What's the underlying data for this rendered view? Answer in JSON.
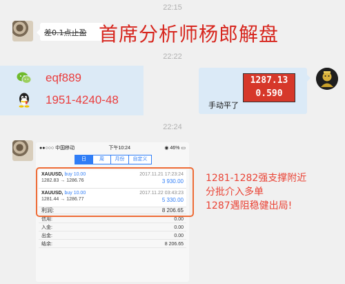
{
  "timestamps": [
    "22:15",
    "22:22",
    "22:24"
  ],
  "msg1": {
    "text": "差0.1点止盈",
    "watermark": "首席分析师杨郎解盘"
  },
  "contacts": {
    "wechat": "eqf889",
    "qq": "1951-4240-48",
    "wechat_icon": "wechat-icon",
    "qq_icon": "qq-icon"
  },
  "reply": {
    "price_line1": "1287.13",
    "price_line2": "0.590",
    "text": "手动平了"
  },
  "phone": {
    "carrier": "●●○○○ 中国移动",
    "time": "下午10:24",
    "battery": "46%",
    "tabs": [
      "日",
      "周",
      "月份",
      "自定义"
    ],
    "active_tab": 0,
    "trades": [
      {
        "symbol": "XAUUSD,",
        "side": "buy 10.00",
        "date": "2017.11.21 17:23:24",
        "prices": "1282.83 → 1286.76",
        "profit": "3 930.00"
      },
      {
        "symbol": "XAUUSD,",
        "side": "buy 10.00",
        "date": "2017.11.22 03:43:23",
        "prices": "1281.44 → 1286.77",
        "profit": "5 330.00"
      }
    ],
    "summary": [
      {
        "label": "利润:",
        "value": "8 206.65"
      },
      {
        "label": "信用:",
        "value": "0.00"
      },
      {
        "label": "入金:",
        "value": "0.00"
      },
      {
        "label": "出金:",
        "value": "0.00"
      },
      {
        "label": "结余:",
        "value": "8 206.65"
      }
    ]
  },
  "note": [
    "1281-1282强支撑附近",
    "分批介入多单",
    "1287遇阻稳健出局!"
  ],
  "colors": {
    "accent_red": "#ea3d3d",
    "ios_blue": "#2f7df6",
    "highlight_orange": "#ee6b35"
  }
}
